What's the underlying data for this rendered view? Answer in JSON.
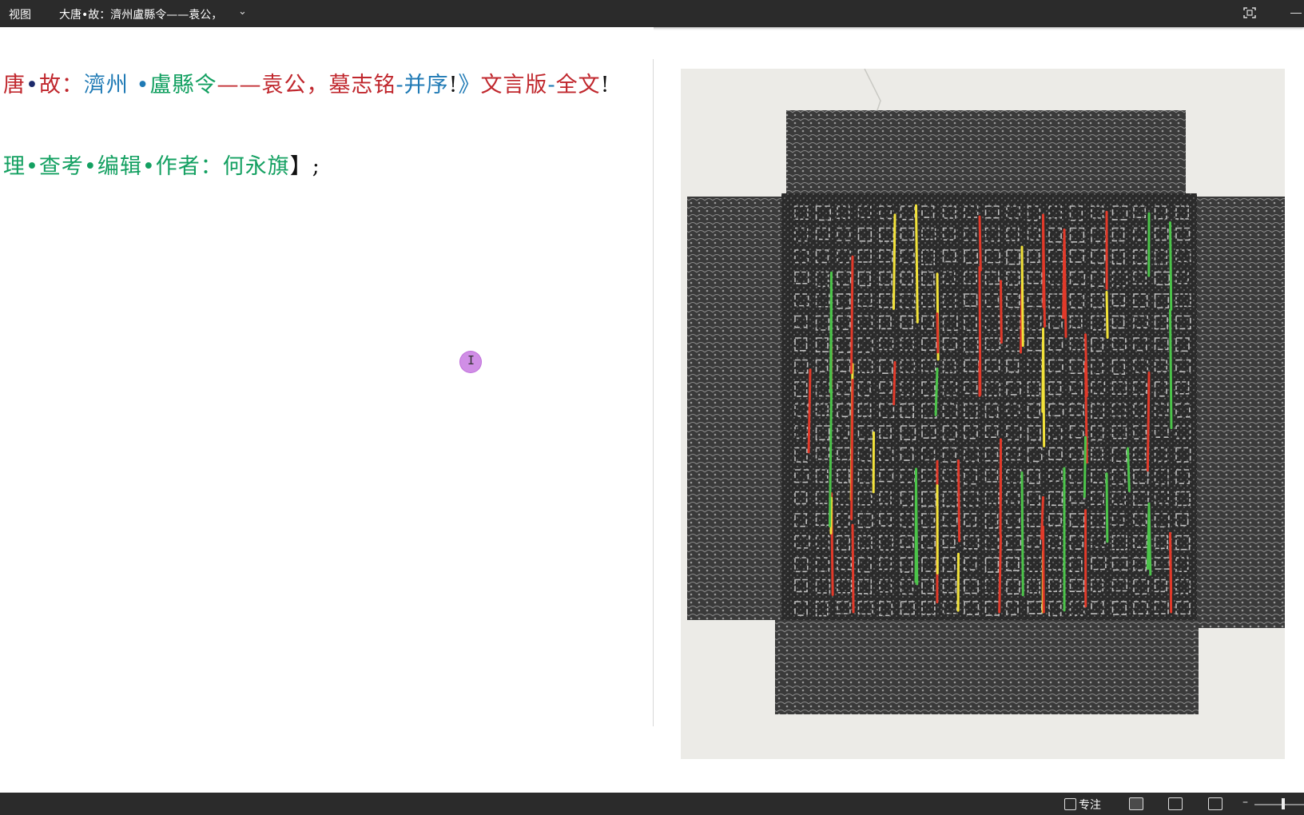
{
  "topbar": {
    "menu_view": "视图",
    "doc_title": "大唐•故：濟州盧縣令——袁公，",
    "title_chevron": "⌄"
  },
  "document": {
    "line1": [
      {
        "t": "唐",
        "c": "red"
      },
      {
        "t": "•",
        "c": "navy"
      },
      {
        "t": "故：",
        "c": "red"
      },
      {
        "t": "濟州",
        "c": "blue"
      },
      {
        "t": "  •",
        "c": "blue"
      },
      {
        "t": "盧縣令",
        "c": "green"
      },
      {
        "t": "——袁公，墓志铭",
        "c": "red"
      },
      {
        "t": "-并序",
        "c": "blue"
      },
      {
        "t": "!",
        "c": "black"
      },
      {
        "t": "》",
        "c": "blue"
      },
      {
        "t": "文言版",
        "c": "red"
      },
      {
        "t": "-",
        "c": "blue"
      },
      {
        "t": "全文",
        "c": "red"
      },
      {
        "t": "!",
        "c": "black"
      }
    ],
    "line2": [
      {
        "t": "理•查考•编辑•作者：何永旗",
        "c": "green"
      },
      {
        "t": "】;",
        "c": "black"
      }
    ]
  },
  "cursor": {
    "glyph": "I"
  },
  "statusbar": {
    "focus_label": "专注"
  },
  "colors": {
    "red": "#c0272d",
    "blue": "#1f7ab5",
    "green": "#13a061",
    "navy": "#1c2a6b",
    "topbar": "#2b2b2b"
  }
}
